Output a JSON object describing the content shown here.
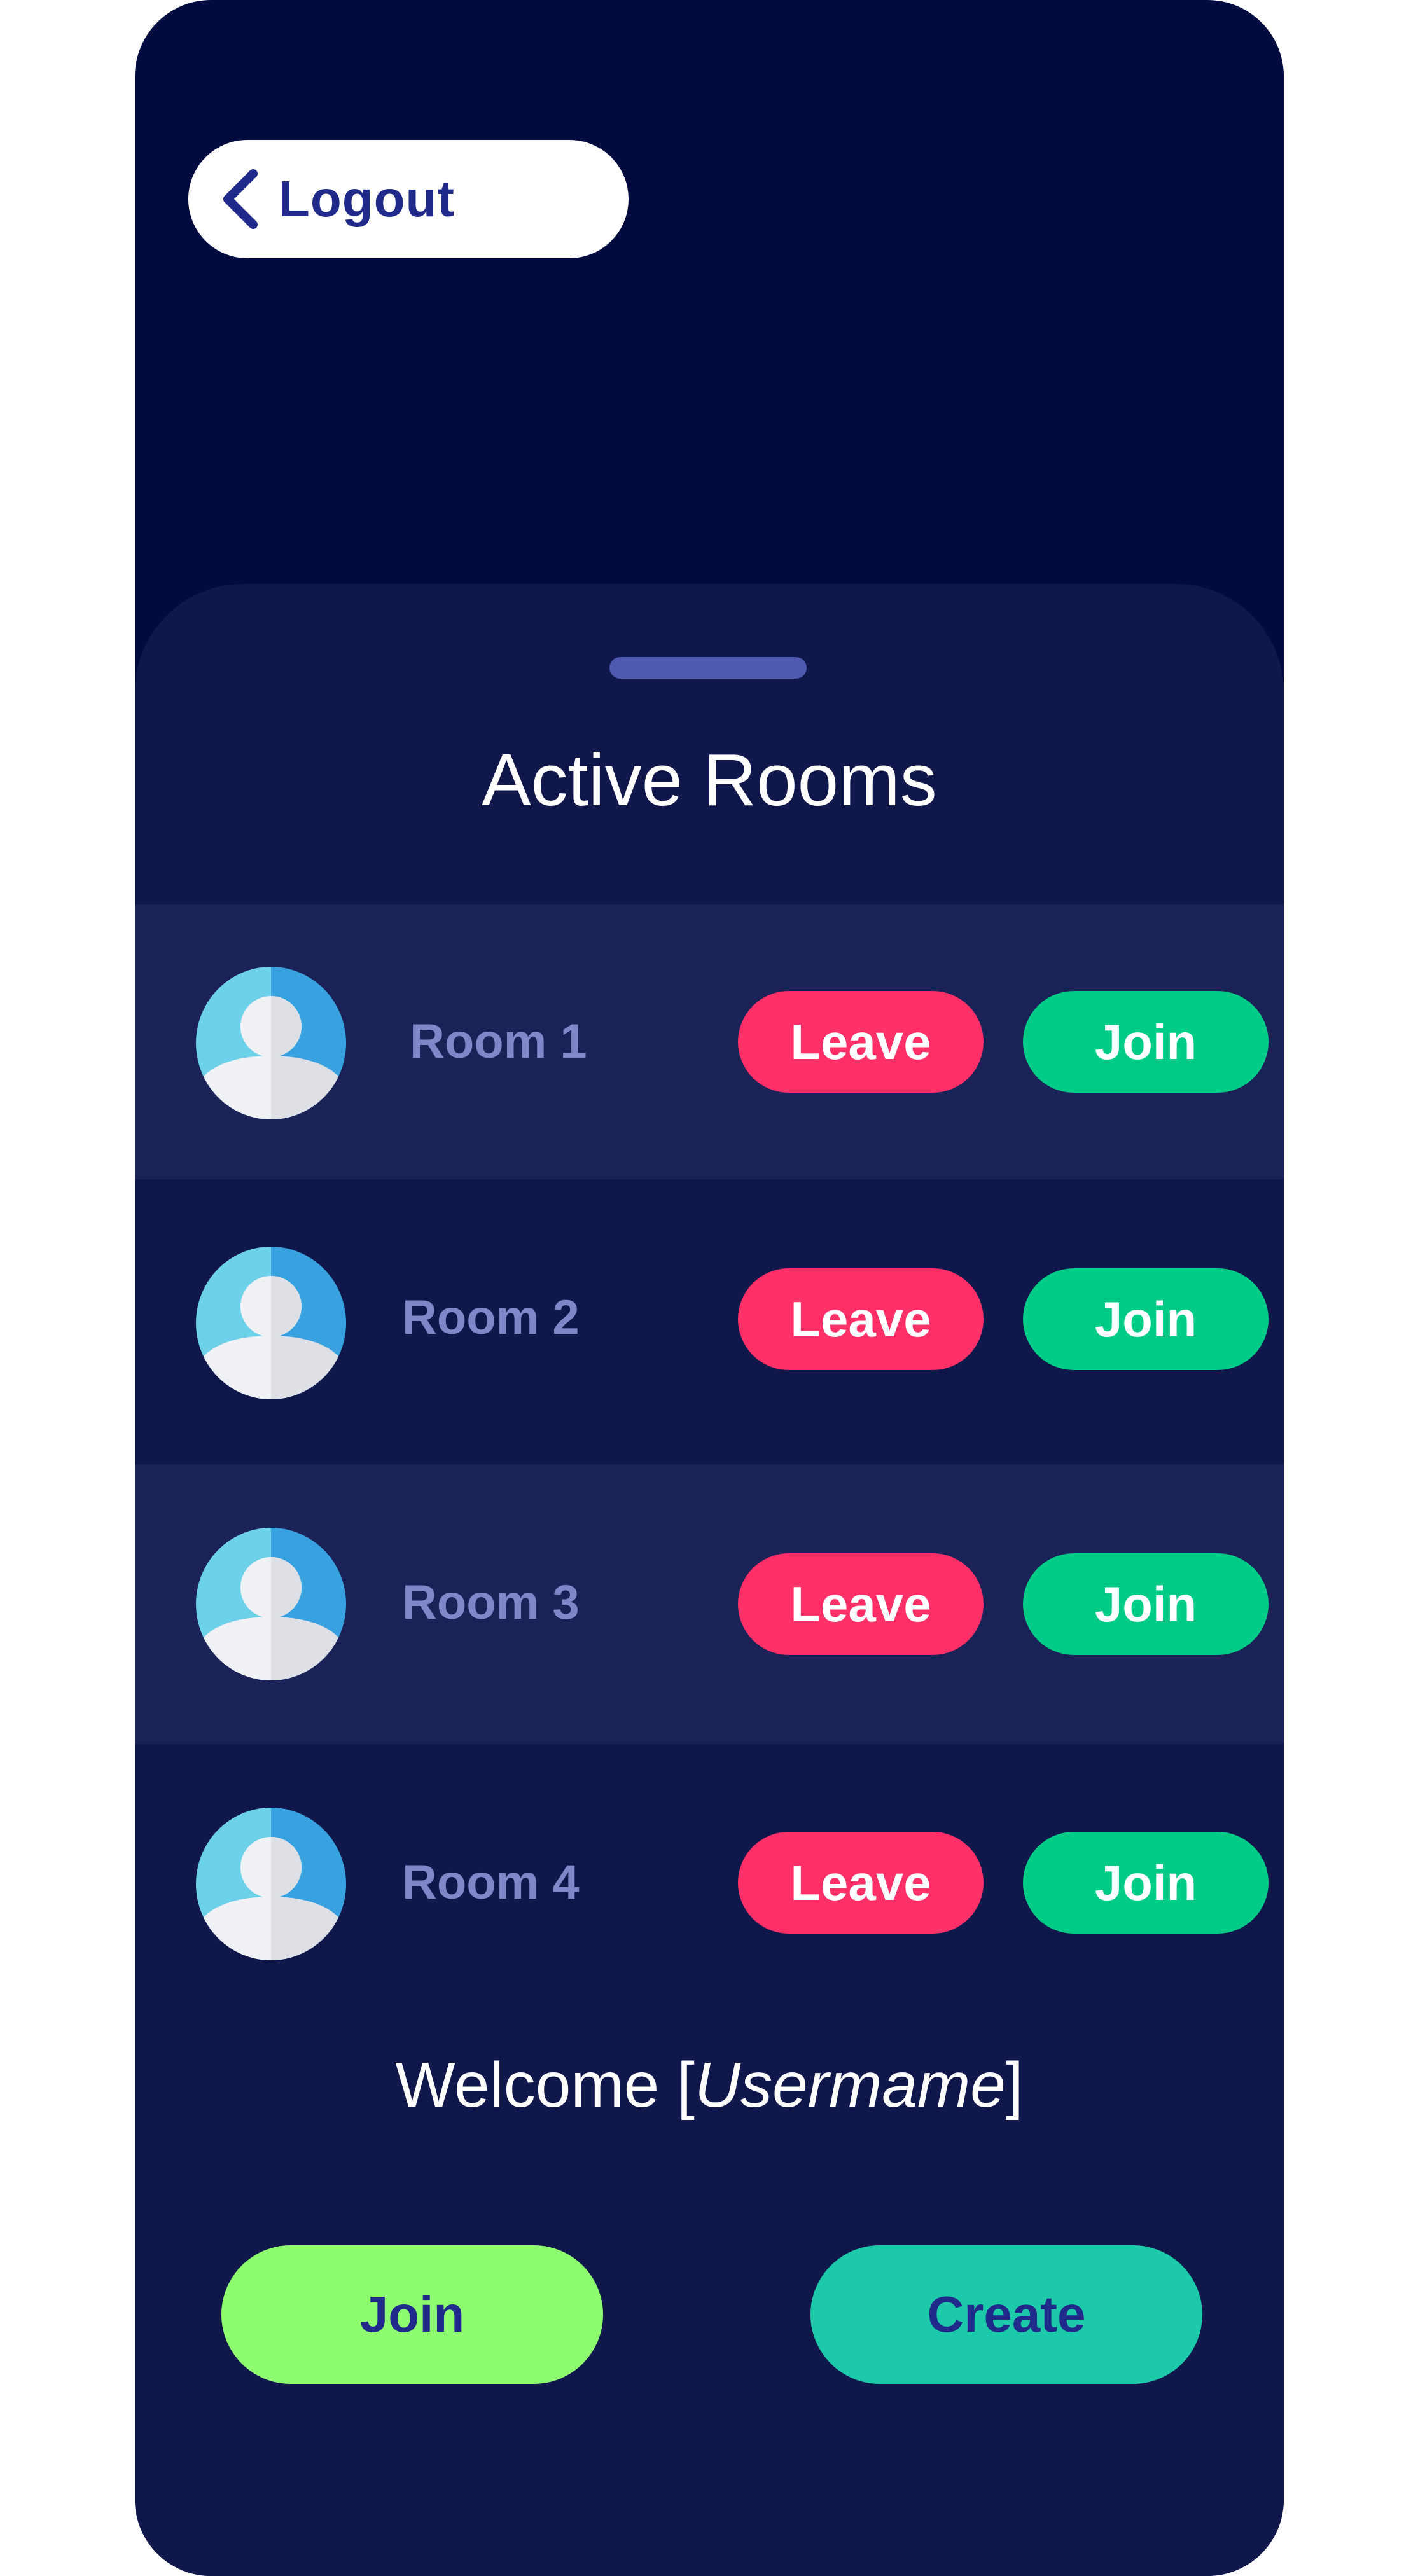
{
  "header": {
    "logout_label": "Logout",
    "logout_icon": "chevron-left-icon"
  },
  "sheet": {
    "title": "Active Rooms"
  },
  "rooms": [
    {
      "name": "Room 1",
      "leave_label": "Leave",
      "join_label": "Join",
      "avatar_icon": "user-avatar-icon"
    },
    {
      "name": "Room 2",
      "leave_label": "Leave",
      "join_label": "Join",
      "avatar_icon": "user-avatar-icon"
    },
    {
      "name": "Room 3",
      "leave_label": "Leave",
      "join_label": "Join",
      "avatar_icon": "user-avatar-icon"
    },
    {
      "name": "Room 4",
      "leave_label": "Leave",
      "join_label": "Join",
      "avatar_icon": "user-avatar-icon"
    }
  ],
  "welcome": {
    "prefix": "Welcome [",
    "username": "Usermame",
    "suffix": "]"
  },
  "actions": {
    "join_label": "Join",
    "create_label": "Create"
  },
  "colors": {
    "background": "#020b3f",
    "sheet": "#10184b",
    "row_highlight": "#1b2257",
    "leave": "#ff2f67",
    "join": "#00cc88",
    "join_main": "#8dfc6e",
    "create_main": "#1ccaa9",
    "accent_text": "#1f2a8a"
  }
}
